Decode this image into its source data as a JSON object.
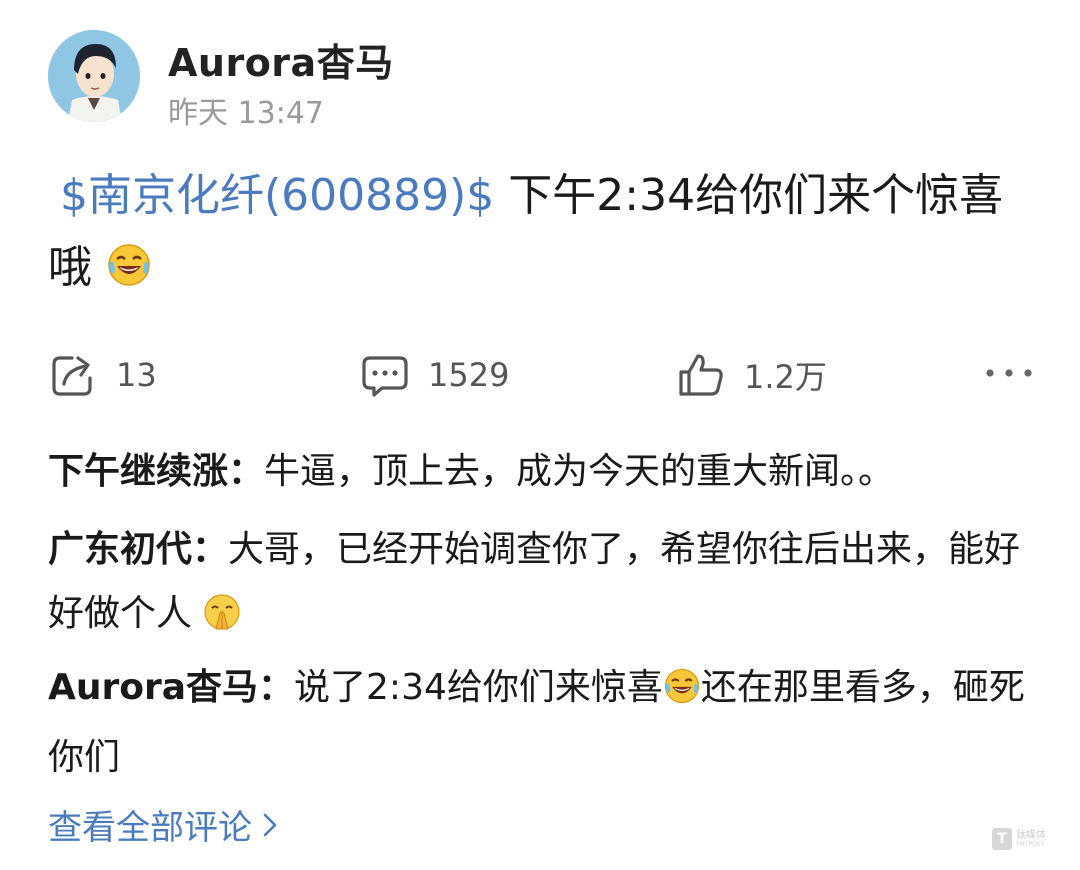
{
  "post": {
    "author": "Aurora杳马",
    "time": "昨天 13:47",
    "stock_tag": "$南京化纤(600889)$",
    "text": "下午2:34给你们来个惊喜哦",
    "text_emoji": "laugh-cry-emoji"
  },
  "actions": {
    "share_count": "13",
    "comment_count": "1529",
    "like_count": "1.2万",
    "share_icon": "share-icon",
    "comment_icon": "comment-icon",
    "like_icon": "thumbs-up-icon",
    "more_icon": "more-icon"
  },
  "comments": [
    {
      "user": "下午继续涨：",
      "text": "牛逼，顶上去，成为今天的重大新闻。。"
    },
    {
      "user": "广东初代：",
      "text": "大哥，已经开始调查你了，希望你往后出来，能好好做个人",
      "emoji": "praying-emoji"
    },
    {
      "user": "Aurora杳马：",
      "text_a": "说了2:34给你们来惊喜",
      "text_b": "还在那里看多，砸死你们",
      "emoji": "laugh-cry-emoji"
    }
  ],
  "view_all_comments": "查看全部评论",
  "watermark": {
    "logo": "T",
    "text_line1": "钛媒体",
    "text_line2": "TMTPOST"
  },
  "colors": {
    "link_blue": "#4a7bbf",
    "text": "#1a1a1a",
    "muted": "#9a9a9a"
  }
}
